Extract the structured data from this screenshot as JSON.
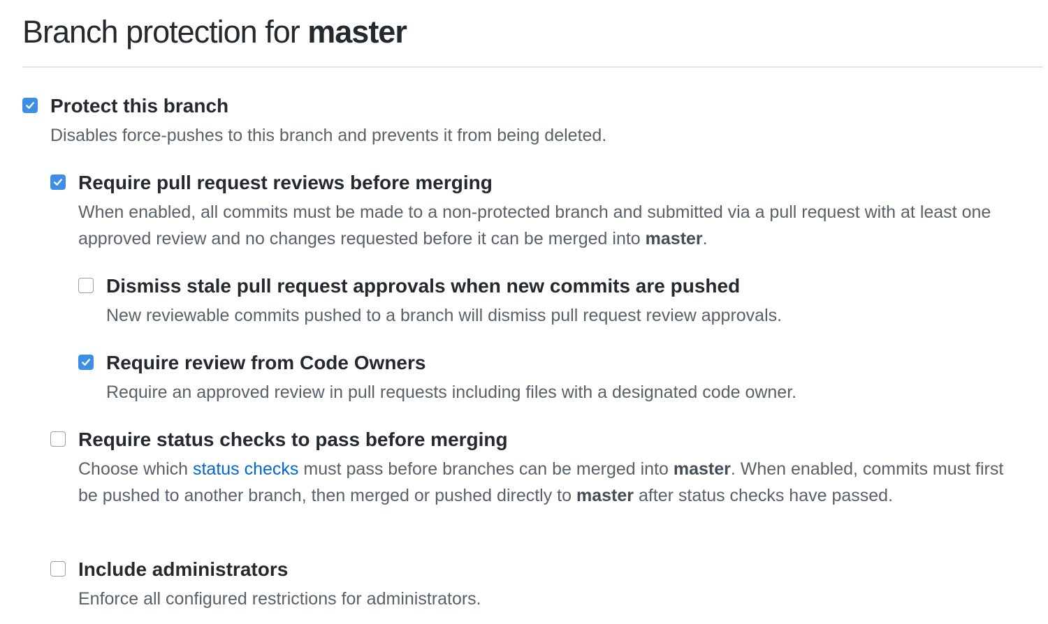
{
  "header": {
    "title_prefix": "Branch protection for",
    "branch_name": "master"
  },
  "colors": {
    "checkbox_checked": "#3f8ee6",
    "link": "#0366d6",
    "description_text": "#586069"
  },
  "options": {
    "protect_branch": {
      "checked": true,
      "title": "Protect this branch",
      "description": "Disables force-pushes to this branch and prevents it from being deleted."
    },
    "require_reviews": {
      "checked": true,
      "title": "Require pull request reviews before merging",
      "description_part1": "When enabled, all commits must be made to a non-protected branch and submitted via a pull request with at least one approved review and no changes requested before it can be merged into",
      "branch": "master",
      "description_end": "."
    },
    "dismiss_stale": {
      "checked": false,
      "title": "Dismiss stale pull request approvals when new commits are pushed",
      "description": "New reviewable commits pushed to a branch will dismiss pull request review approvals."
    },
    "code_owners": {
      "checked": true,
      "title": "Require review from Code Owners",
      "description": "Require an approved review in pull requests including files with a designated code owner."
    },
    "status_checks": {
      "checked": false,
      "title": "Require status checks to pass before merging",
      "desc_before_link": "Choose which",
      "link_text": "status checks",
      "desc_after_link": "must pass before branches can be merged into",
      "branch": "master",
      "desc_middle": ". When enabled, commits must first be pushed to another branch, then merged or pushed directly to",
      "branch2": "master",
      "desc_end": "after status checks have passed."
    },
    "include_admins": {
      "checked": false,
      "title": "Include administrators",
      "description": "Enforce all configured restrictions for administrators."
    }
  }
}
